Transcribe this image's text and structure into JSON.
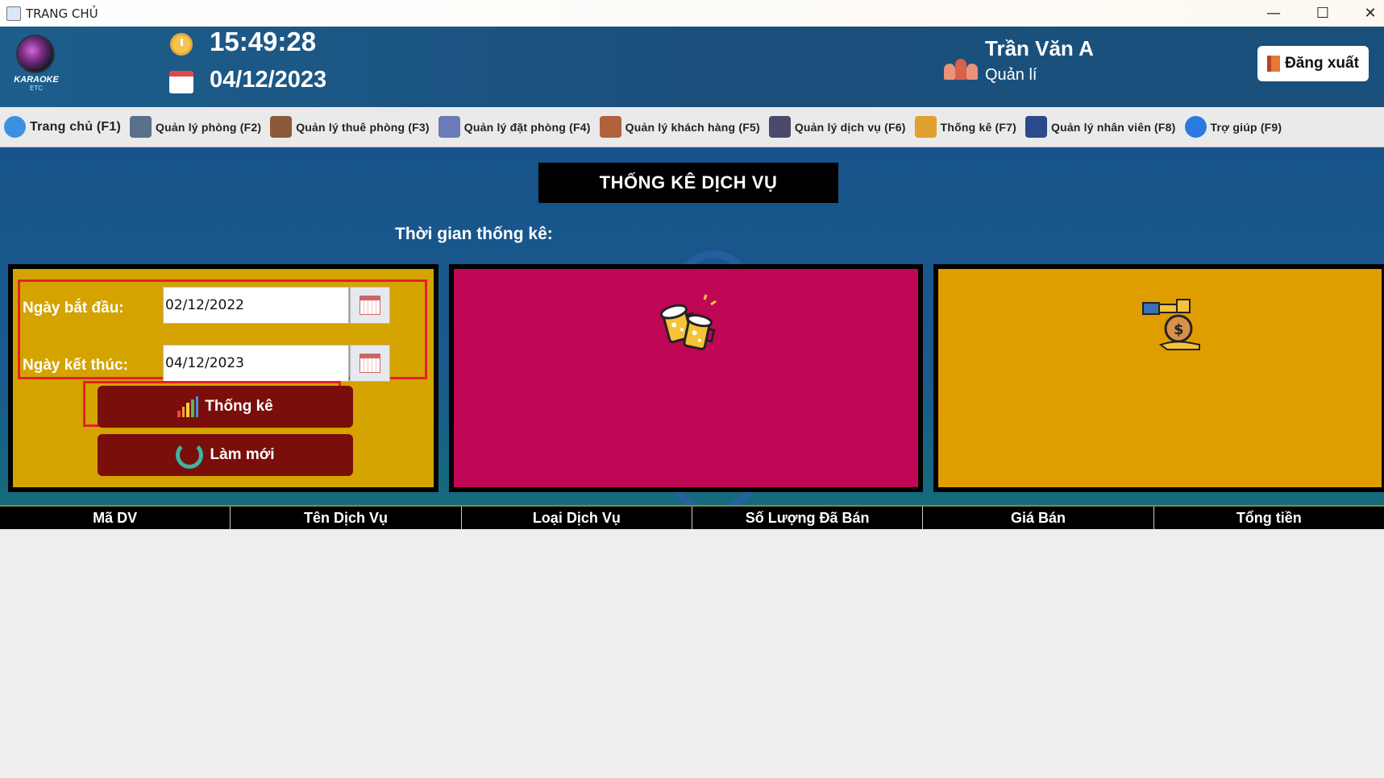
{
  "window": {
    "title": "TRANG CHỦ",
    "minimize": "—",
    "maximize": "☐",
    "close": "✕"
  },
  "header": {
    "logo_text": "KARAOKE",
    "logo_sub": "ETC",
    "time": "15:49:28",
    "date": "04/12/2023",
    "user_name": "Trần Văn A",
    "user_role": "Quản lí",
    "logout_label": "Đăng xuất"
  },
  "nav": [
    {
      "label": "Trang chủ (F1)",
      "icon": "home-icon",
      "color": "#3d8fe0"
    },
    {
      "label": "Quản lý phòng (F2)",
      "icon": "building-icon",
      "color": "#5a6f8a"
    },
    {
      "label": "Quản lý thuê phòng (F3)",
      "icon": "rent-house-icon",
      "color": "#8a5a3a"
    },
    {
      "label": "Quản lý đặt phòng (F4)",
      "icon": "booking-icon",
      "color": "#6a7bb8"
    },
    {
      "label": "Quản lý khách hàng (F5)",
      "icon": "customers-icon",
      "color": "#b0623a"
    },
    {
      "label": "Quản lý dịch vụ (F6)",
      "icon": "waiter-icon",
      "color": "#4a4a6a"
    },
    {
      "label": "Thống kê (F7)",
      "icon": "chart-icon",
      "color": "#e0a030"
    },
    {
      "label": "Quản lý nhân viên (F8)",
      "icon": "staff-icon",
      "color": "#2a4a8a"
    },
    {
      "label": "Trợ giúp (F9)",
      "icon": "help-icon",
      "color": "#2a7ae0"
    }
  ],
  "main": {
    "title": "THỐNG KÊ DỊCH VỤ",
    "time_label": "Thời gian thống kê:",
    "start_label": "Ngày bắt đầu:",
    "start_value": "02/12/2022",
    "end_label": "Ngày kết thúc:",
    "end_value": "04/12/2023",
    "stat_button": "Thống kê",
    "refresh_button": "Làm mới",
    "colors": {
      "left_panel": "#d4a300",
      "mid_panel": "#c00756",
      "right_panel": "#e09d00",
      "button": "#7a0e0b"
    }
  },
  "table": {
    "columns": [
      "Mã DV",
      "Tên Dịch Vụ",
      "Loại Dịch Vụ",
      "Số Lượng Đã Bán",
      "Giá Bán",
      "Tổng tiền"
    ]
  }
}
